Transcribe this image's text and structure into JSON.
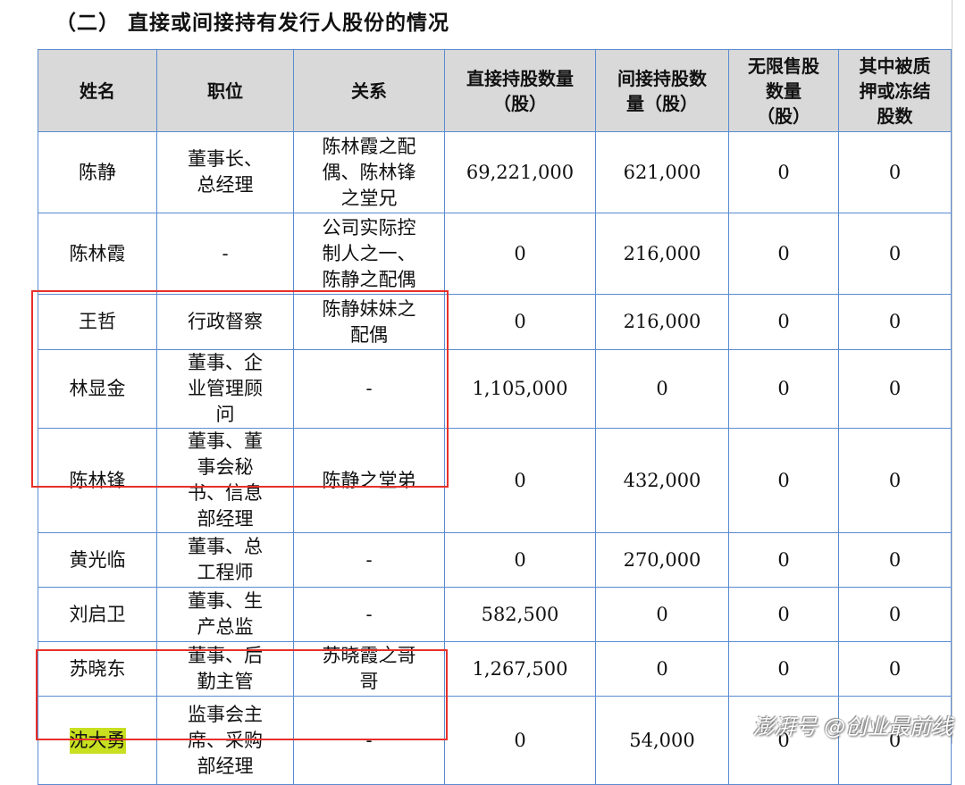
{
  "title": "（二）  直接或间接持有发行人股份的情况",
  "headers": [
    "姓名",
    "职位",
    "关系",
    "直接持股数量（股）",
    "间接持股数量（股）",
    "无限售股数量（股）",
    "其中被质押或冻结股数"
  ],
  "rows": [
    [
      "陈静",
      "董事长、总经理",
      "陈林霞之配偶、陈林锋之堂兄",
      "69,221,000",
      "621,000",
      "0",
      "0"
    ],
    [
      "陈林霞",
      "-",
      "公司实际控制人之一、陈静之配偶",
      "0",
      "216,000",
      "0",
      "0"
    ],
    [
      "王哲",
      "行政督察",
      "陈静妹妹之配偶",
      "0",
      "216,000",
      "0",
      "0"
    ],
    [
      "林显金",
      "董事、企业管理顾问",
      "-",
      "1,105,000",
      "0",
      "0",
      "0"
    ],
    [
      "陈林锋",
      "董事、董事会秘书、信息部经理",
      "陈静之堂弟",
      "0",
      "432,000",
      "0",
      "0"
    ],
    [
      "黄光临",
      "董事、总工程师",
      "-",
      "0",
      "270,000",
      "0",
      "0"
    ],
    [
      "刘启卫",
      "董事、生产总监",
      "-",
      "582,500",
      "0",
      "0",
      "0"
    ],
    [
      "苏晓东",
      "董事、后勤主管",
      "苏晓霞之哥哥",
      "1,267,500",
      "0",
      "0",
      "0"
    ],
    [
      "沈大勇",
      "监事会主席、采购部经理",
      "-",
      "0",
      "54,000",
      "0",
      "0"
    ]
  ],
  "highlight_color": "#c8e020",
  "annotation_color": "#e8302a",
  "watermark": "澎湃号 @创业最前线"
}
